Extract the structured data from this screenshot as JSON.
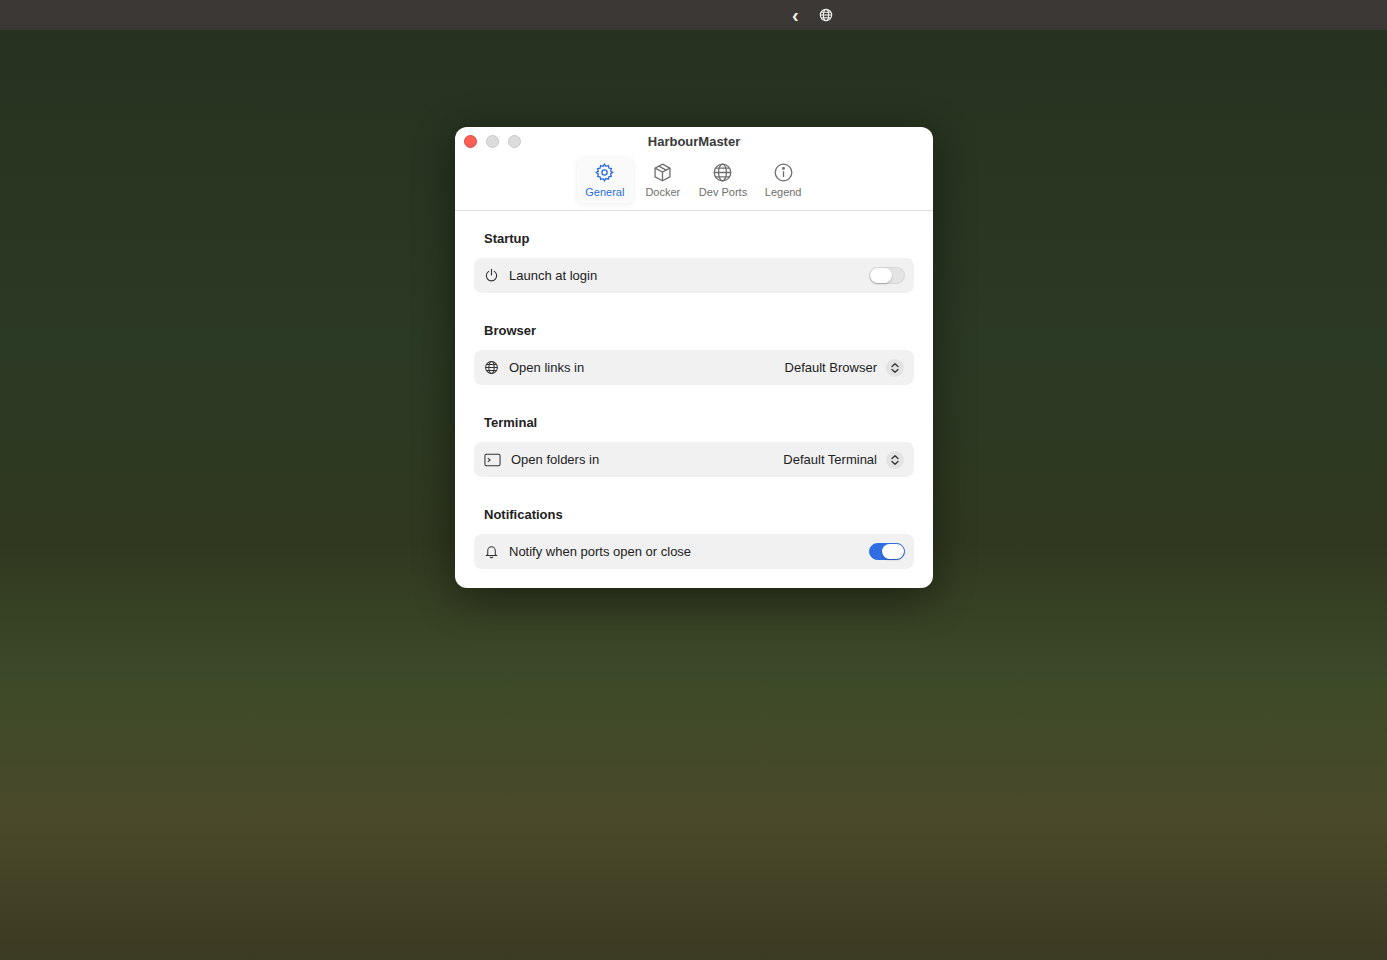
{
  "menubar": {
    "chevron": "‹"
  },
  "window": {
    "title": "HarbourMaster"
  },
  "tabs": [
    {
      "label": "General",
      "selected": true
    },
    {
      "label": "Docker",
      "selected": false
    },
    {
      "label": "Dev Ports",
      "selected": false
    },
    {
      "label": "Legend",
      "selected": false
    }
  ],
  "sections": [
    {
      "title": "Startup",
      "rows": [
        {
          "kind": "toggle",
          "label": "Launch at login",
          "on": false
        }
      ]
    },
    {
      "title": "Browser",
      "rows": [
        {
          "kind": "select",
          "label": "Open links in",
          "value": "Default Browser"
        }
      ]
    },
    {
      "title": "Terminal",
      "rows": [
        {
          "kind": "select",
          "label": "Open folders in",
          "value": "Default Terminal"
        }
      ]
    },
    {
      "title": "Notifications",
      "rows": [
        {
          "kind": "toggle",
          "label": "Notify when ports open or close",
          "on": true
        }
      ]
    }
  ]
}
